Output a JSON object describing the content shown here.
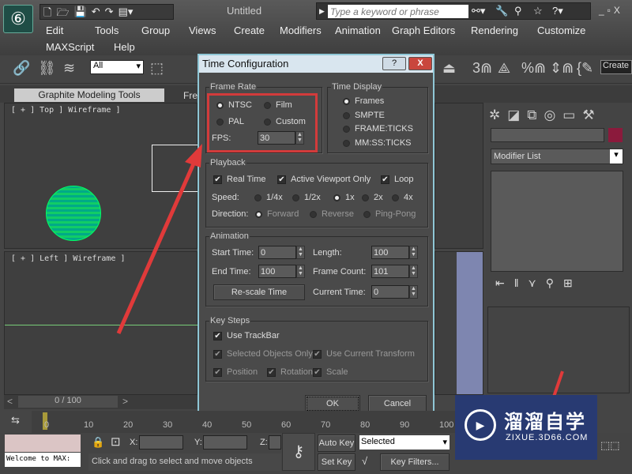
{
  "app": {
    "title": "Untitled",
    "logo_icon": "3dsmax-logo",
    "search_placeholder": "Type a keyword or phrase",
    "menu_row1": [
      "Edit",
      "Tools",
      "Group",
      "Views",
      "Create",
      "Modifiers",
      "Animation",
      "Graph Editors",
      "Rendering",
      "Customize"
    ],
    "menu_row2": [
      "MAXScript",
      "Help"
    ],
    "selection_filter": "All",
    "ribbon_tab": "Graphite Modeling Tools",
    "ribbon_tab2": "Fre",
    "create_field": "Create"
  },
  "viewports": {
    "top": "[ + ] Top ] Wireframe ]",
    "left": "[ + ] Left ] Wireframe ]"
  },
  "command_panel": {
    "modifier_list": "Modifier List",
    "accent": "#8b1a3c"
  },
  "dialog": {
    "title": "Time Configuration",
    "help": "?",
    "close": "X",
    "frame_rate": {
      "legend": "Frame Rate",
      "options": [
        "NTSC",
        "Film",
        "PAL",
        "Custom"
      ],
      "selected": "NTSC",
      "fps_label": "FPS:",
      "fps": "30"
    },
    "time_display": {
      "legend": "Time Display",
      "options": [
        "Frames",
        "SMPTE",
        "FRAME:TICKS",
        "MM:SS:TICKS"
      ],
      "selected": "Frames"
    },
    "playback": {
      "legend": "Playback",
      "real_time": "Real Time",
      "active_viewport_only": "Active Viewport Only",
      "loop": "Loop",
      "speed_label": "Speed:",
      "speeds": [
        "1/4x",
        "1/2x",
        "1x",
        "2x",
        "4x"
      ],
      "speed_selected": "1x",
      "direction_label": "Direction:",
      "directions": [
        "Forward",
        "Reverse",
        "Ping-Pong"
      ],
      "direction_selected": "Forward"
    },
    "animation": {
      "legend": "Animation",
      "start_label": "Start Time:",
      "start": "0",
      "length_label": "Length:",
      "length": "100",
      "end_label": "End Time:",
      "end": "100",
      "frame_count_label": "Frame Count:",
      "frame_count": "101",
      "rescale": "Re-scale Time",
      "current_label": "Current Time:",
      "current": "0"
    },
    "key_steps": {
      "legend": "Key Steps",
      "use_trackbar": "Use TrackBar",
      "selected_only": "Selected Objects Only",
      "use_current": "Use Current Transform",
      "position": "Position",
      "rotation": "Rotation",
      "scale": "Scale"
    },
    "ok": "OK",
    "cancel": "Cancel"
  },
  "timeline": {
    "slider": "0 / 100",
    "ticks": [
      "0",
      "10",
      "20",
      "30",
      "40",
      "50",
      "60",
      "70",
      "80",
      "90",
      "100"
    ]
  },
  "status": {
    "welcome": "Welcome to MAX:",
    "x_label": "X:",
    "y_label": "Y:",
    "z_label": "Z:",
    "prompt": "Click and drag to select and move objects",
    "auto_key": "Auto Key",
    "set_key": "Set Key",
    "key_mode": "Selected",
    "key_filters": "Key Filters..."
  },
  "watermark": {
    "brand": "溜溜自学",
    "url": "ZIXUE.3D66.COM"
  },
  "annotation_color": "#d23b3b"
}
